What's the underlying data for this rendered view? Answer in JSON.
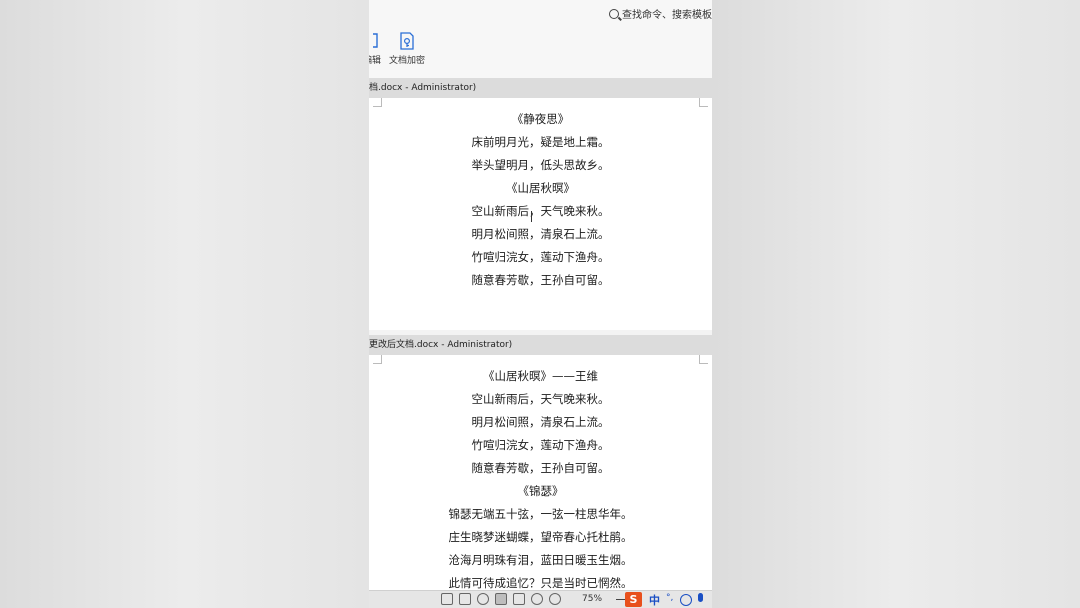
{
  "search": {
    "label": "查找命令、搜索模板"
  },
  "ribbon": {
    "edit_label": "编辑",
    "encrypt_label": "文档加密"
  },
  "windows": [
    {
      "title": "档.docx - Administrator)",
      "lines": [
        "《静夜思》",
        "床前明月光，疑是地上霜。",
        "举头望明月，低头思故乡。",
        "《山居秋暝》",
        "空山新雨后，天气晚来秋。",
        "明月松间照，清泉石上流。",
        "竹喧归浣女，莲动下渔舟。",
        "随意春芳歇，王孙自可留。"
      ]
    },
    {
      "title": "更改后文档.docx - Administrator)",
      "lines": [
        "《山居秋暝》——王维",
        "空山新雨后，天气晚来秋。",
        "明月松间照，清泉石上流。",
        "竹喧归浣女，莲动下渔舟。",
        "随意春芳歇，王孙自可留。",
        "《锦瑟》",
        "锦瑟无端五十弦，一弦一柱思华年。",
        "庄生晓梦迷蝴蝶，望帝春心托杜鹃。",
        "沧海月明珠有泪，蓝田日暖玉生烟。",
        "此情可待成追忆？只是当时已惘然。"
      ]
    }
  ],
  "statusbar": {
    "zoom": "75%",
    "ime_logo": "S",
    "ime_mode": "中",
    "ime_punct": "°,"
  },
  "icons": [
    "search-icon",
    "edit-icon",
    "document-encrypt-icon",
    "fullscreen-icon",
    "reading-mode-icon",
    "pen-icon",
    "page-view-icon",
    "outline-view-icon",
    "web-view-icon",
    "eye-protection-icon",
    "sogou-ime-icon",
    "smile-icon",
    "microphone-icon"
  ]
}
